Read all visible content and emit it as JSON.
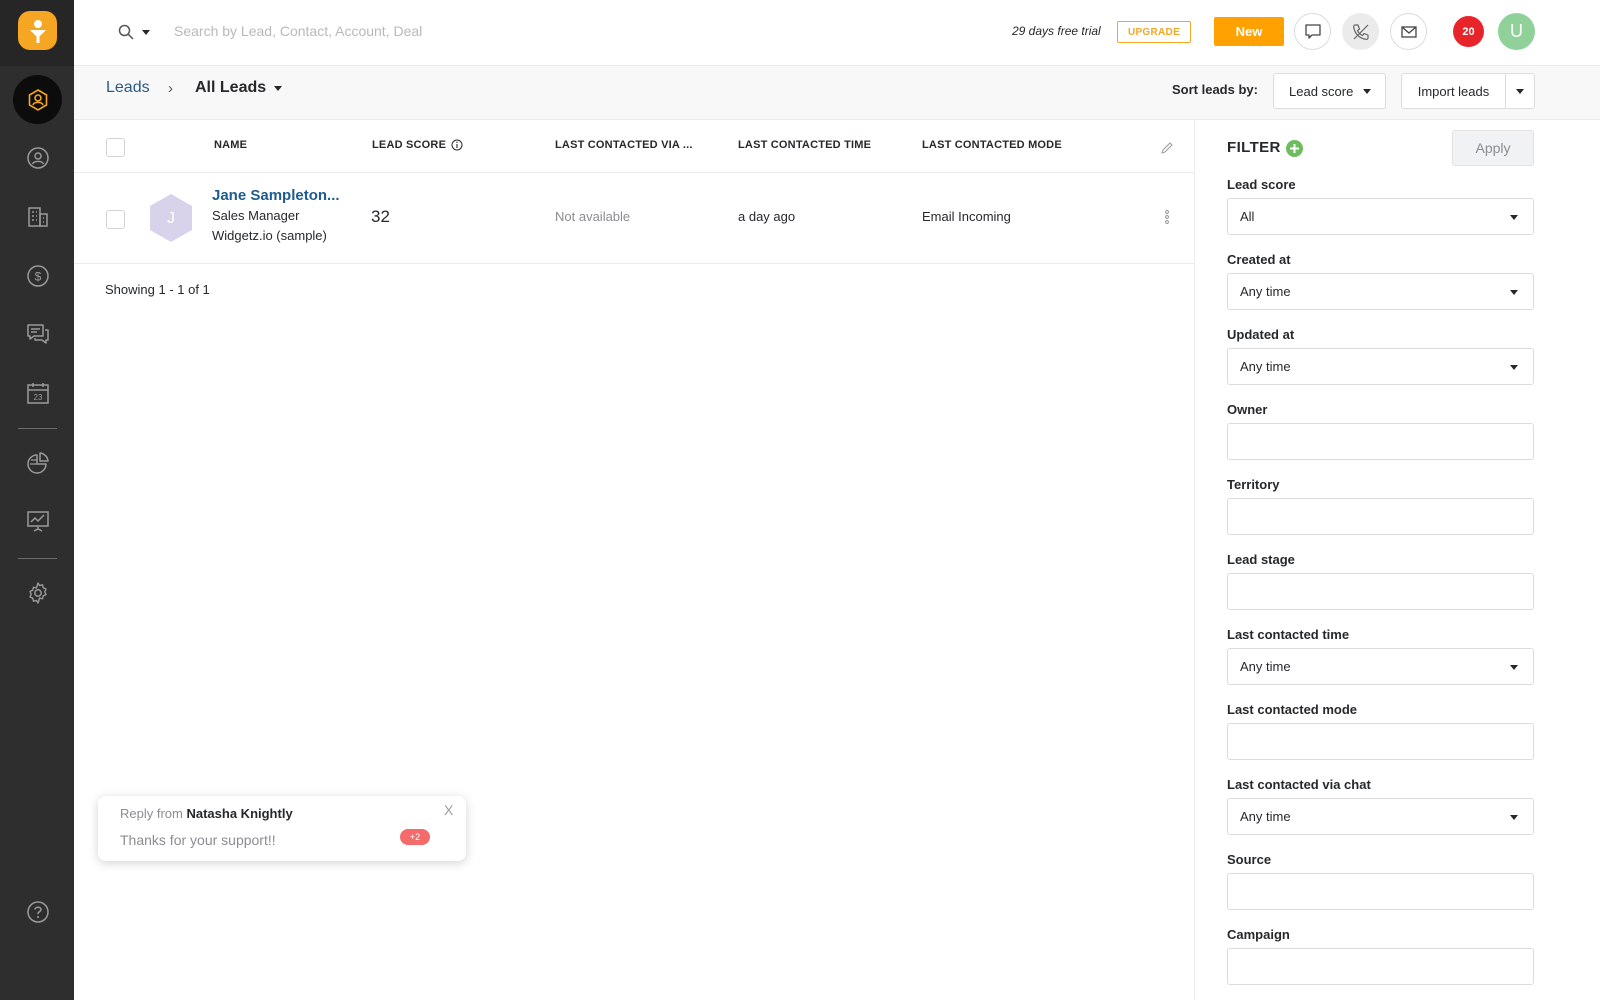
{
  "header": {
    "search_placeholder": "Search by Lead, Contact, Account, Deal",
    "trial_text": "29 days free trial",
    "upgrade_label": "UPGRADE",
    "new_label": "New",
    "notification_count": "20",
    "user_initial": "U"
  },
  "sidebar": {
    "items": [
      {
        "icon": "leads-icon",
        "active": true
      },
      {
        "icon": "contacts-icon"
      },
      {
        "icon": "accounts-icon"
      },
      {
        "icon": "deals-icon"
      },
      {
        "icon": "conversations-icon"
      },
      {
        "icon": "calendar-icon"
      },
      {
        "icon": "reports-icon"
      },
      {
        "icon": "analytics-icon"
      },
      {
        "icon": "settings-icon"
      },
      {
        "icon": "help-icon"
      }
    ]
  },
  "breadcrumb": {
    "root": "Leads",
    "separator": "›",
    "current": "All Leads"
  },
  "toolbar": {
    "sort_label": "Sort leads by:",
    "sort_value": "Lead score",
    "import_label": "Import leads"
  },
  "table": {
    "columns": [
      "NAME",
      "LEAD SCORE",
      "LAST CONTACTED VIA ...",
      "LAST CONTACTED TIME",
      "LAST CONTACTED MODE"
    ],
    "rows": [
      {
        "avatar_initial": "J",
        "name": "Jane Sampleton...",
        "title": "Sales Manager",
        "company": "Widgetz.io (sample)",
        "lead_score": "32",
        "last_contacted_via": "Not available",
        "last_contacted_time": "a day ago",
        "last_contacted_mode": "Email Incoming"
      }
    ],
    "showing": "Showing 1 - 1 of 1"
  },
  "filter": {
    "title": "FILTER",
    "apply_label": "Apply",
    "fields": [
      {
        "label": "Lead score",
        "value": "All",
        "dropdown": true
      },
      {
        "label": "Created at",
        "value": "Any time",
        "dropdown": true
      },
      {
        "label": "Updated at",
        "value": "Any time",
        "dropdown": true
      },
      {
        "label": "Owner",
        "value": "",
        "dropdown": false
      },
      {
        "label": "Territory",
        "value": "",
        "dropdown": false
      },
      {
        "label": "Lead stage",
        "value": "",
        "dropdown": false
      },
      {
        "label": "Last contacted time",
        "value": "Any time",
        "dropdown": true
      },
      {
        "label": "Last contacted mode",
        "value": "",
        "dropdown": false
      },
      {
        "label": "Last contacted via chat",
        "value": "Any time",
        "dropdown": true
      },
      {
        "label": "Source",
        "value": "",
        "dropdown": false
      },
      {
        "label": "Campaign",
        "value": "",
        "dropdown": false
      }
    ]
  },
  "toast": {
    "prefix": "Reply from",
    "sender": "Natasha Knightly",
    "message": "Thanks for your support!!",
    "badge": "+2",
    "close": "X"
  },
  "colors": {
    "sidebar": "#2e2e2e",
    "brand": "#f5a623",
    "new_button": "#ffa101",
    "link": "#1f5b8f",
    "notification": "#e8242b",
    "avatar": "#8fd199",
    "filter_add": "#6ebd5d"
  }
}
